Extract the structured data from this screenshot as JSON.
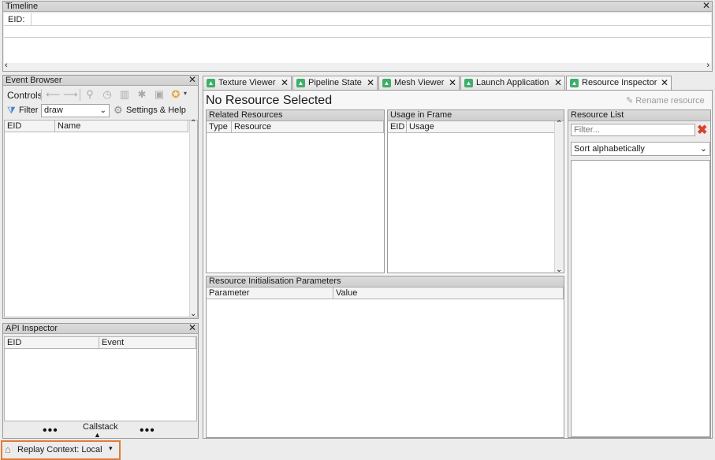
{
  "timeline": {
    "title": "Timeline",
    "eid_label": "EID:"
  },
  "event_browser": {
    "title": "Event Browser",
    "controls_label": "Controls",
    "filter_label": "Filter",
    "filter_value": "draw",
    "settings_label": "Settings & Help",
    "columns": [
      "EID",
      "Name"
    ]
  },
  "api_inspector": {
    "title": "API Inspector",
    "columns": [
      "EID",
      "Event"
    ],
    "callstack_label": "Callstack"
  },
  "tabs": [
    {
      "label": "Texture Viewer"
    },
    {
      "label": "Pipeline State"
    },
    {
      "label": "Mesh Viewer"
    },
    {
      "label": "Launch Application"
    },
    {
      "label": "Resource Inspector"
    }
  ],
  "resource_inspector": {
    "heading": "No Resource Selected",
    "rename_label": "Rename resource",
    "related": {
      "title": "Related Resources",
      "columns": [
        "Type",
        "Resource"
      ]
    },
    "usage": {
      "title": "Usage in Frame",
      "columns": [
        "EID",
        "Usage"
      ]
    },
    "init_params": {
      "title": "Resource Initialisation Parameters",
      "columns": [
        "Parameter",
        "Value"
      ]
    },
    "resource_list": {
      "title": "Resource List",
      "filter_placeholder": "Filter...",
      "sort_value": "Sort alphabetically"
    }
  },
  "status_bar": {
    "replay_context": "Replay Context: Local"
  },
  "colors": {
    "accent_tab_icon": "#3fae6a",
    "clear_icon": "#d9412b",
    "highlight_border": "#e07b3a"
  }
}
